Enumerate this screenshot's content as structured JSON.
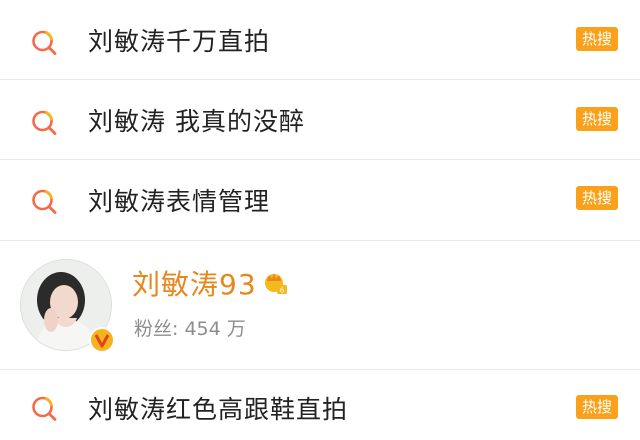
{
  "hot_badge_color": "#f9a11b",
  "name_color": "#e8871d",
  "search_items": [
    {
      "text": "刘敏涛千万直拍",
      "badge": "热搜",
      "icon": "search-icon"
    },
    {
      "text": "刘敏涛 我真的没醉",
      "badge": "热搜",
      "icon": "search-icon"
    },
    {
      "text": "刘敏涛表情管理",
      "badge": "热搜",
      "icon": "search-icon"
    },
    {
      "text": "刘敏涛红色高跟鞋直拍",
      "badge": "热搜",
      "icon": "search-icon"
    }
  ],
  "user_card": {
    "name": "刘敏涛",
    "level": "93",
    "fans_label": "粉丝:",
    "fans_count": "454",
    "fans_unit": "万",
    "icons": [
      "avatar",
      "verified-v-icon",
      "crown-level-icon"
    ]
  }
}
